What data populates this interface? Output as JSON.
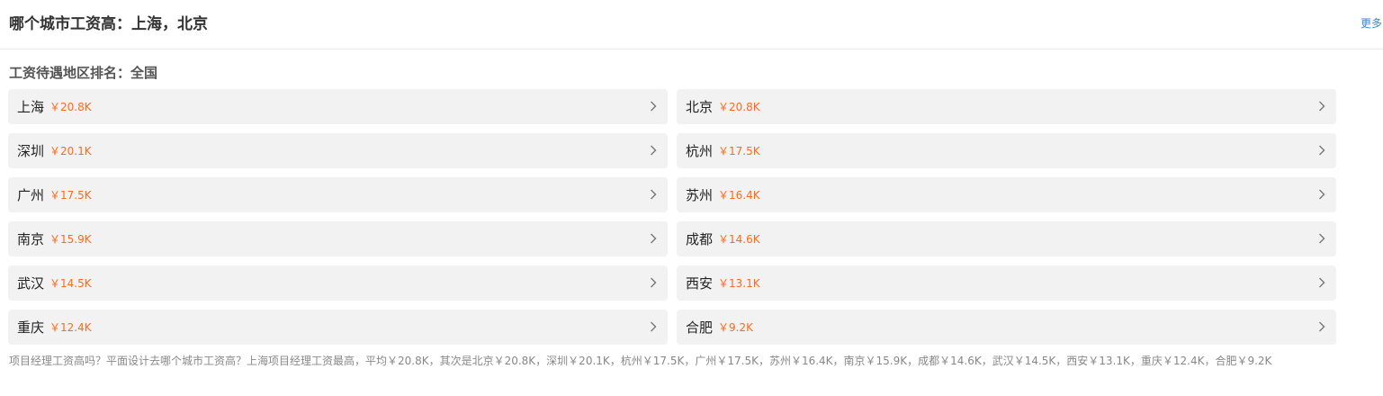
{
  "header": {
    "title": "哪个城市工资高：上海，北京",
    "more_label": "更多"
  },
  "ranking": {
    "subtitle": "工资待遇地区排名：全国",
    "items": [
      {
        "city": "上海",
        "salary": "￥20.8K"
      },
      {
        "city": "北京",
        "salary": "￥20.8K"
      },
      {
        "city": "深圳",
        "salary": "￥20.1K"
      },
      {
        "city": "杭州",
        "salary": "￥17.5K"
      },
      {
        "city": "广州",
        "salary": "￥17.5K"
      },
      {
        "city": "苏州",
        "salary": "￥16.4K"
      },
      {
        "city": "南京",
        "salary": "￥15.9K"
      },
      {
        "city": "成都",
        "salary": "￥14.6K"
      },
      {
        "city": "武汉",
        "salary": "￥14.5K"
      },
      {
        "city": "西安",
        "salary": "￥13.1K"
      },
      {
        "city": "重庆",
        "salary": "￥12.4K"
      },
      {
        "city": "合肥",
        "salary": "￥9.2K"
      }
    ],
    "chevron_icon": "chevron-right-icon"
  },
  "summary": {
    "text": "项目经理工资高吗？平面设计去哪个城市工资高？上海项目经理工资最高，平均￥20.8K，其次是北京￥20.8K，深圳￥20.1K，杭州￥17.5K，广州￥17.5K，苏州￥16.4K，南京￥15.9K，成都￥14.6K，武汉￥14.5K，西安￥13.1K，重庆￥12.4K，合肥￥9.2K"
  },
  "colors": {
    "salary": "#ff6a1a",
    "link": "#3e86d6",
    "item_bg": "#f2f2f2"
  }
}
